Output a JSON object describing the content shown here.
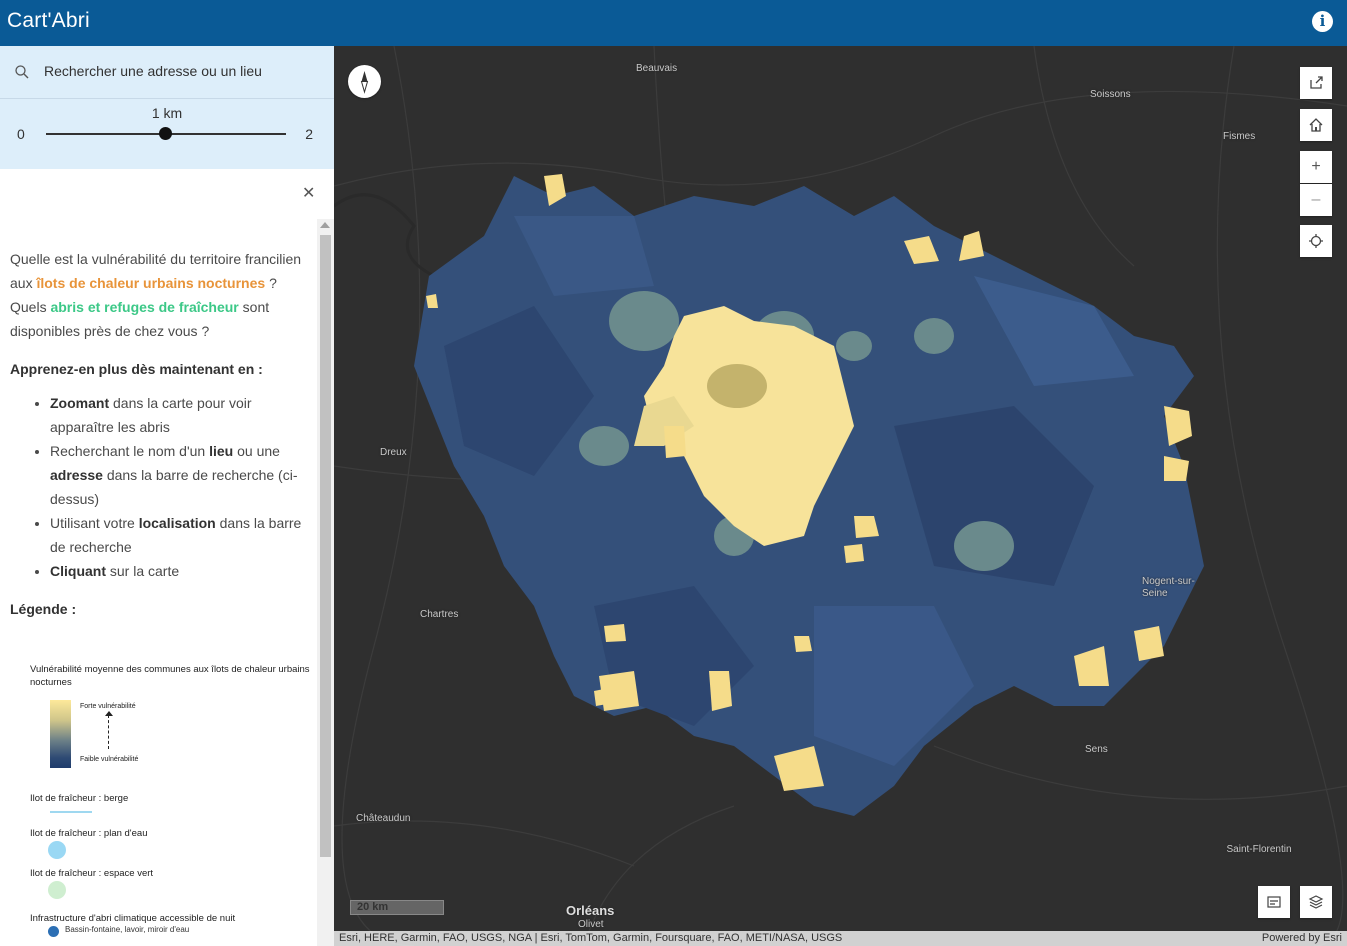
{
  "header": {
    "title": "Cart'Abri",
    "info_icon": "info-icon"
  },
  "search": {
    "placeholder": "Rechercher une adresse ou un lieu"
  },
  "slider": {
    "value_label": "1 km",
    "min_label": "0",
    "max_label": "2",
    "value": 1,
    "min": 0,
    "max": 2
  },
  "panel": {
    "intro_1": "Quelle est la vulnérabilité du territoire francilien aux ",
    "intro_orange": "îlots de chaleur urbains nocturnes",
    "intro_2": " ? Quels ",
    "intro_green": "abris et refuges de fraîcheur",
    "intro_3": " sont disponibles près de chez vous ?",
    "heading_learn": "Apprenez-en plus dès maintenant en :",
    "bullets": [
      {
        "bold": "Zoomant",
        "rest": " dans la carte pour voir apparaître les abris"
      },
      {
        "pre": "Recherchant le nom d'un ",
        "bold1": "lieu",
        "mid": " ou une ",
        "bold2": "adresse",
        "rest": " dans la barre de recherche (ci-dessus)"
      },
      {
        "pre": "Utilisant votre ",
        "bold": "localisation",
        "rest": " dans la barre de recherche"
      },
      {
        "bold": "Cliquant",
        "rest": " sur la carte"
      }
    ],
    "heading_legend": "Légende :"
  },
  "legend": {
    "title": "Vulnérabilité moyenne des communes aux îlots de chaleur urbains nocturnes",
    "high_label": "Forte vulnérabilité",
    "low_label": "Faible vulnérabilité",
    "items": [
      "Ilot de fraîcheur : berge",
      "Ilot de fraîcheur : plan d'eau",
      "Ilot de fraîcheur : espace vert",
      "Infrastructure d'abri climatique accessible de nuit"
    ],
    "sub_item": "Bassin-fontaine, lavoir, miroir d'eau",
    "colors": {
      "high": "#fde99a",
      "low": "#1f3c6c",
      "berge": "#9fd8f0",
      "plan_eau": "#9ad8f4",
      "espace_vert": "#cfeed0",
      "fontaine": "#2c6fb4"
    }
  },
  "map": {
    "places": [
      "Beauvais",
      "Soissons",
      "Fismes",
      "Dreux",
      "Chartres",
      "Sens",
      "Châteaudun",
      "Nogent-sur-Seine",
      "Saint-Florentin",
      "Olivet",
      "Orléans"
    ],
    "scale_label": "20 km",
    "attribution_left": "Esri, HERE, Garmin, FAO, USGS, NGA | Esri, TomTom, Garmin, Foursquare, FAO, METI/NASA, USGS",
    "attribution_right": "Powered by Esri",
    "widgets": [
      "share-icon",
      "home-icon",
      "zoom-in-icon",
      "zoom-out-icon",
      "locate-icon",
      "legend-icon",
      "layers-icon",
      "compass-icon"
    ],
    "zoom_in": "+",
    "zoom_out": "–"
  }
}
